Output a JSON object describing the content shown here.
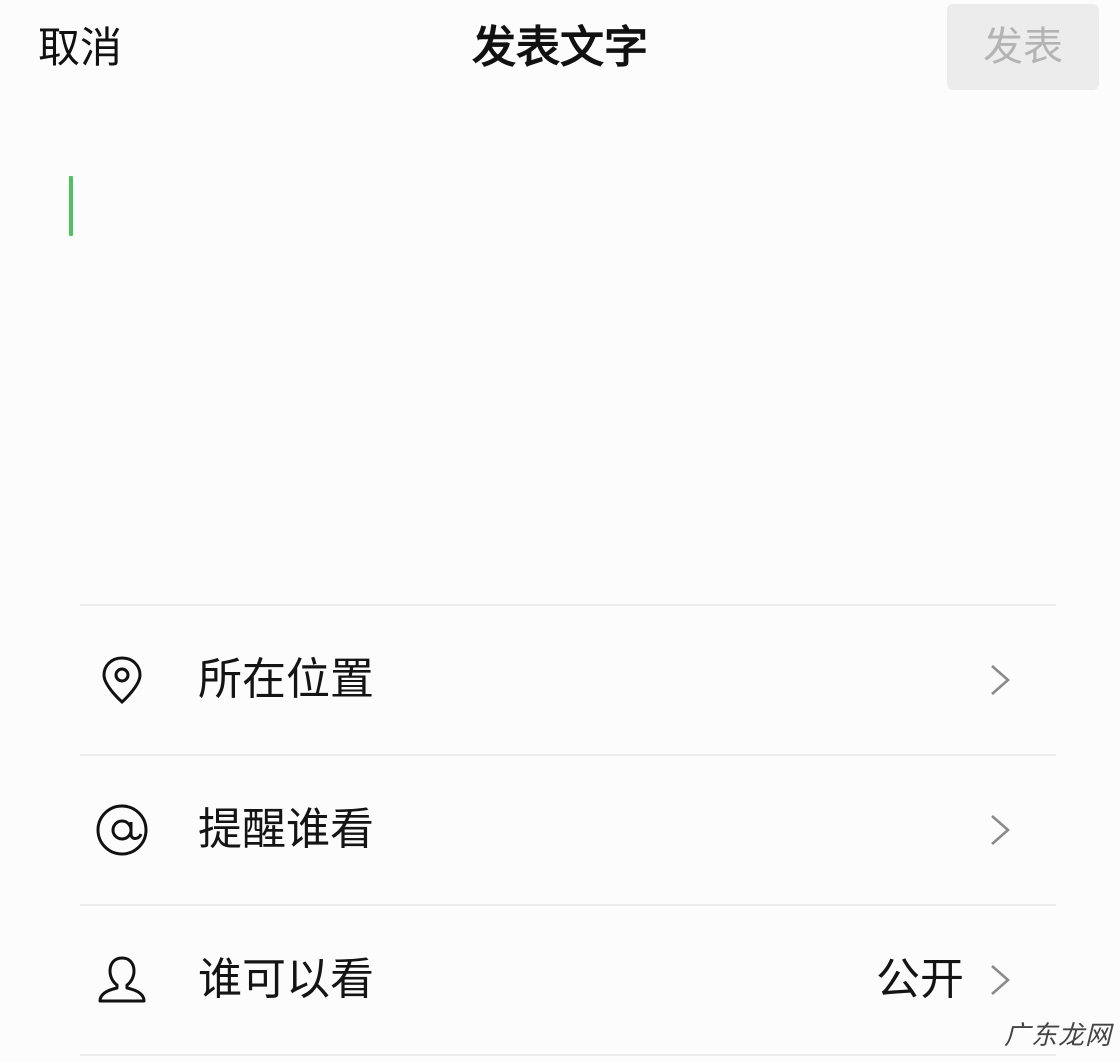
{
  "header": {
    "cancel_label": "取消",
    "title": "发表文字",
    "publish_label": "发表"
  },
  "editor": {
    "value": "",
    "caret_color": "#4fc35f"
  },
  "options": [
    {
      "icon": "location-pin-icon",
      "label": "所在位置",
      "value": ""
    },
    {
      "icon": "at-sign-icon",
      "label": "提醒谁看",
      "value": ""
    },
    {
      "icon": "person-icon",
      "label": "谁可以看",
      "value": "公开"
    }
  ],
  "watermark": "广东龙网",
  "colors": {
    "background": "#fdfcfd",
    "publish_disabled_bg": "#ececec",
    "publish_disabled_text": "#b4b4b4"
  }
}
